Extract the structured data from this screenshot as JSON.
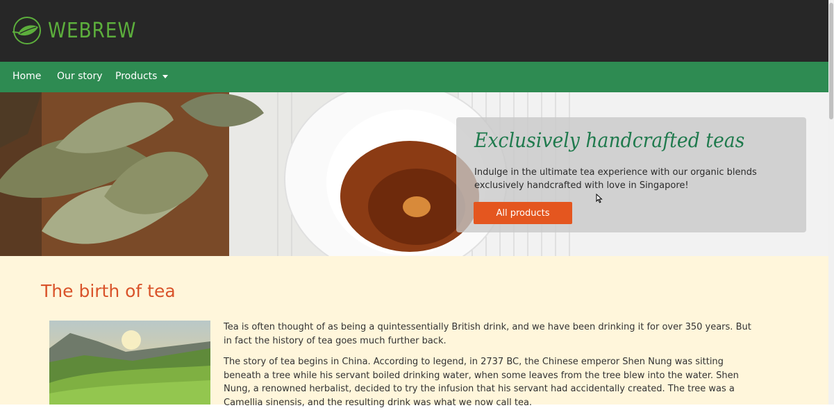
{
  "brand": {
    "name": "WEBREW",
    "logo_icon": "leaf-logo-icon"
  },
  "nav": {
    "items": [
      {
        "label": "Home"
      },
      {
        "label": "Our story"
      },
      {
        "label": "Products"
      }
    ]
  },
  "hero": {
    "title": "Exclusively handcrafted teas",
    "text": "Indulge in the ultimate tea experience with our organic blends exclusively handcrafted with love in Singapore!",
    "button_label": "All products"
  },
  "section": {
    "title": "The birth of tea",
    "paragraphs": [
      "Tea is often thought of as being a quintessentially British drink, and we have been drinking it for over 350 years. But in fact the history of tea goes much further back.",
      "The story of tea begins in China. According to legend, in 2737 BC, the Chinese emperor Shen Nung was sitting beneath a tree while his servant boiled drinking water, when some leaves from the tree blew into the water. Shen Nung, a renowned herbalist, decided to try the infusion that his servant had accidentally created. The tree was a Camellia sinensis, and the resulting drink was what we now call tea."
    ]
  },
  "colors": {
    "topbar": "#272727",
    "navbar": "#2e8b52",
    "brand_green": "#5cae3c",
    "accent_orange": "#e4561f",
    "section_title": "#d9532a",
    "content_bg": "#fff6db"
  }
}
